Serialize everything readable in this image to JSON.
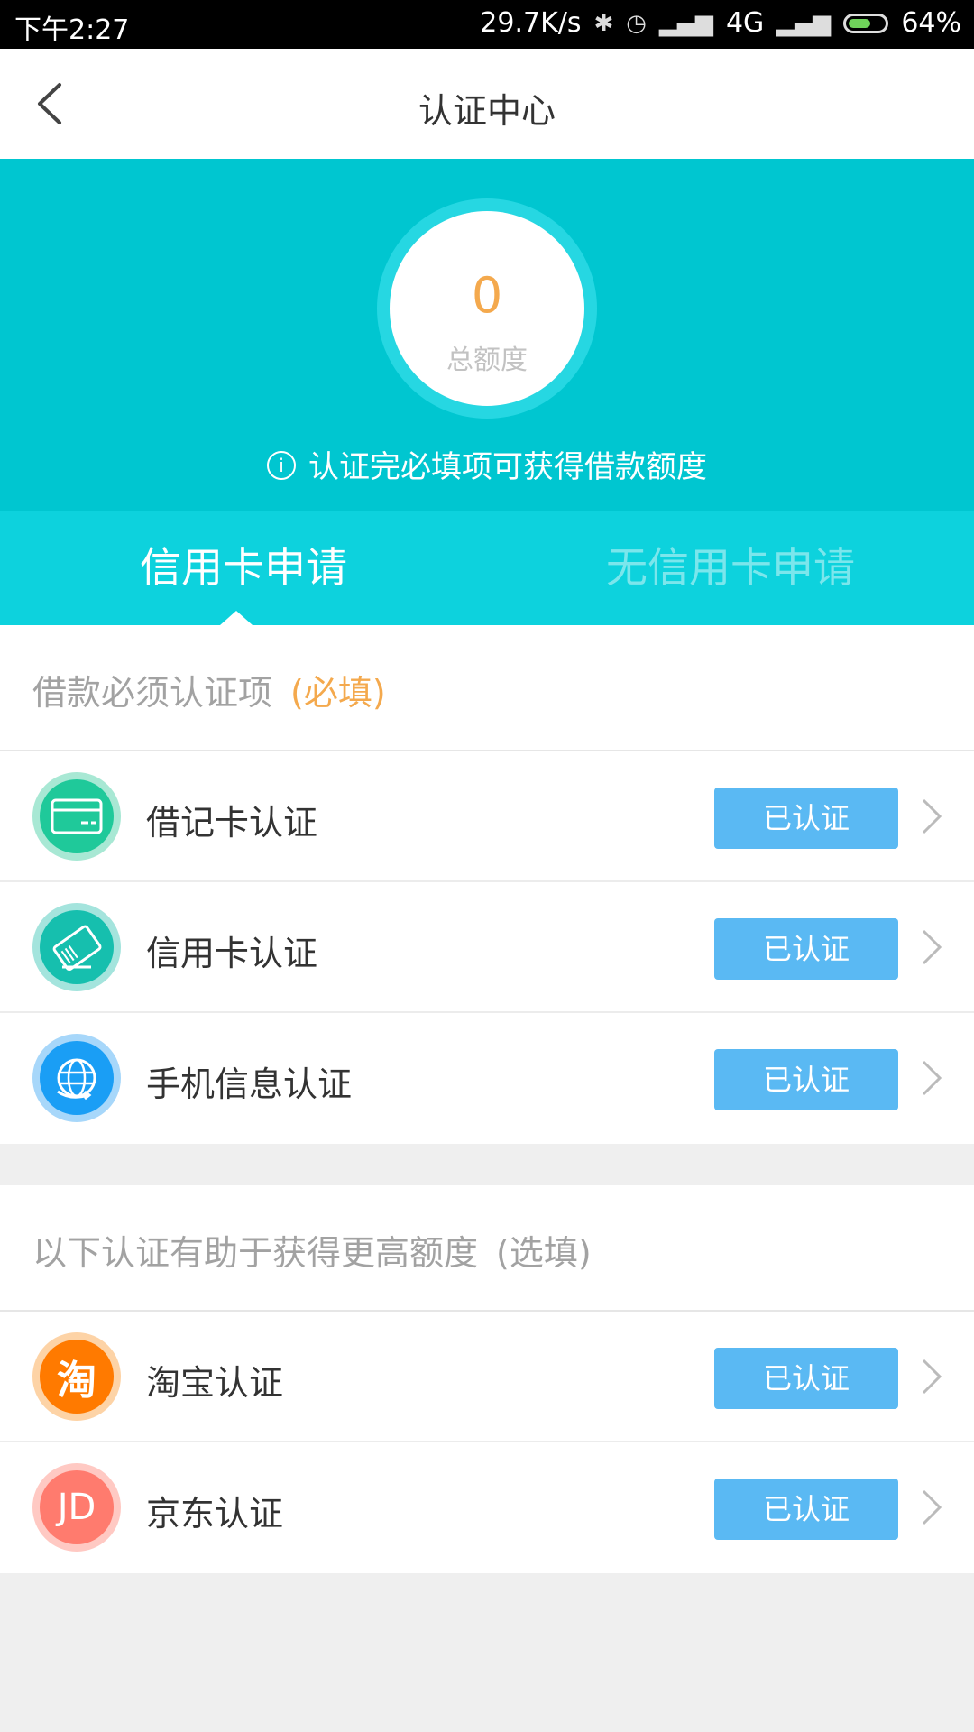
{
  "status": {
    "time": "下午2:27",
    "speed": "29.7K/s",
    "network": "4G",
    "battery": "64%",
    "battery_level": 0.64
  },
  "nav": {
    "title": "认证中心"
  },
  "summary": {
    "amount": "0",
    "amount_label": "总额度",
    "hint": "认证完必填项可获得借款额度"
  },
  "tabs": [
    {
      "label": "信用卡申请"
    },
    {
      "label": "无信用卡申请"
    }
  ],
  "required_section": {
    "title": "借款必须认证项",
    "tag": "(必填)",
    "items": [
      {
        "label": "借记卡认证",
        "status": "已认证",
        "icon": "debit-card-icon"
      },
      {
        "label": "信用卡认证",
        "status": "已认证",
        "icon": "credit-card-icon"
      },
      {
        "label": "手机信息认证",
        "status": "已认证",
        "icon": "phone-info-icon"
      }
    ]
  },
  "optional_section": {
    "title": "以下认证有助于获得更高额度",
    "tag": "(选填)",
    "items": [
      {
        "label": "淘宝认证",
        "status": "已认证",
        "icon": "taobao-icon",
        "glyph": "淘"
      },
      {
        "label": "京东认证",
        "status": "已认证",
        "icon": "jd-icon",
        "glyph": "JD"
      }
    ]
  },
  "colors": {
    "teal": "#00c6d0",
    "badge": "#5ab9f3",
    "accent": "#f4a94d"
  }
}
